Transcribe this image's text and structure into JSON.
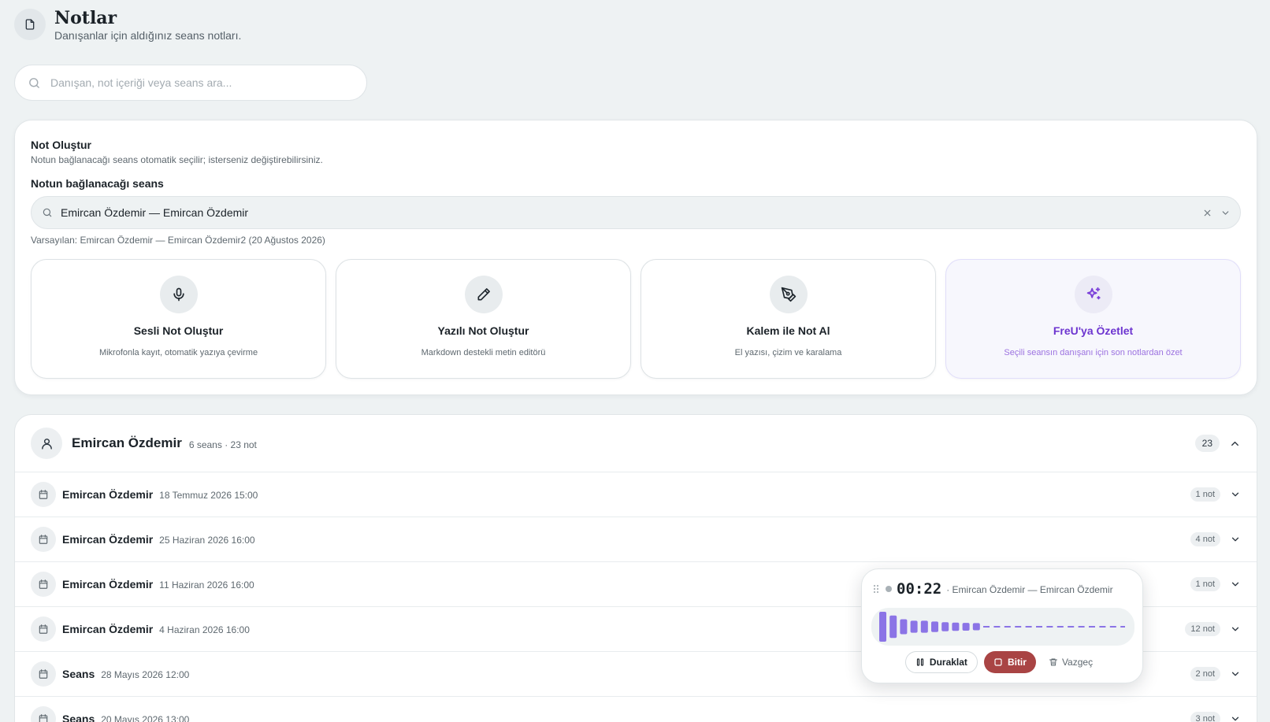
{
  "header": {
    "title": "Notlar",
    "subtitle": "Danışanlar için aldığınız seans notları.",
    "icon": "file-icon"
  },
  "search": {
    "placeholder": "Danışan, not içeriği veya seans ara...",
    "value": ""
  },
  "create": {
    "title": "Not Oluştur",
    "description": "Notun bağlanacağı seans otomatik seçilir; isterseniz değiştirebilirsiniz.",
    "session_label": "Notun bağlanacağı seans",
    "session_value": "Emircan Özdemir — Emircan Özdemir",
    "default_text": "Varsayılan: Emircan Özdemir — Emircan Özdemir2 (20 Ağustos 2026)",
    "actions": [
      {
        "icon": "microphone-icon",
        "title": "Sesli Not Oluştur",
        "description": "Mikrofonla kayıt, otomatik yazıya çevirme"
      },
      {
        "icon": "pencil-icon",
        "title": "Yazılı Not Oluştur",
        "description": "Markdown destekli metin editörü"
      },
      {
        "icon": "pen-tool-icon",
        "title": "Kalem ile Not Al",
        "description": "El yazısı, çizim ve karalama"
      },
      {
        "icon": "sparkles-icon",
        "title": "FreU'ya Özetlet",
        "description": "Seçili seansın danışanı için son notlardan özet"
      }
    ]
  },
  "client": {
    "name": "Emircan Özdemir",
    "meta": "6 seans · 23 not",
    "count": "23",
    "sessions": [
      {
        "name": "Emircan Özdemir",
        "date": "18 Temmuz 2026 15:00",
        "notes": "1 not"
      },
      {
        "name": "Emircan Özdemir",
        "date": "25 Haziran 2026 16:00",
        "notes": "4 not"
      },
      {
        "name": "Emircan Özdemir",
        "date": "11 Haziran 2026 16:00",
        "notes": "1 not"
      },
      {
        "name": "Emircan Özdemir",
        "date": "4 Haziran 2026 16:00",
        "notes": "12 not"
      },
      {
        "name": "Seans",
        "date": "28 Mayıs 2026 12:00",
        "notes": "2 not"
      },
      {
        "name": "Seans",
        "date": "20 Mayıs 2026 13:00",
        "notes": "3 not"
      }
    ]
  },
  "recorder": {
    "time": "00:22",
    "session": "· Emircan Özdemir — Emircan Özdemir",
    "pause_label": "Duraklat",
    "finish_label": "Bitir",
    "cancel_label": "Vazgeç",
    "levels": [
      1.0,
      0.75,
      0.5,
      0.4,
      0.4,
      0.35,
      0.3,
      0.28,
      0.26,
      0.24
    ],
    "accent_color": "#8b74e6",
    "finish_color": "#a94444"
  }
}
